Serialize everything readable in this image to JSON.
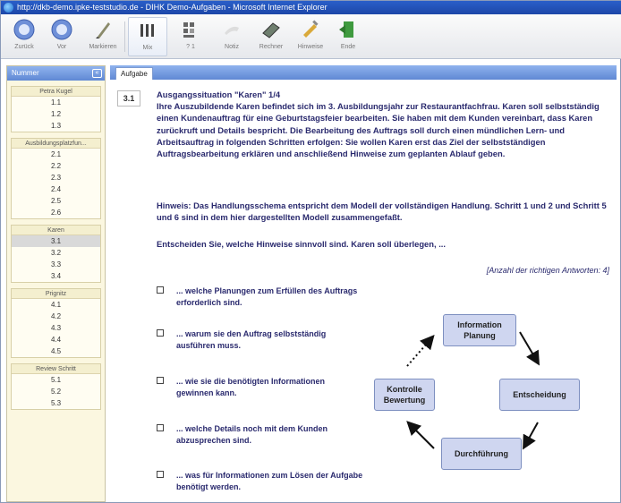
{
  "window": {
    "title": "http://dkb-demo.ipke-teststudio.de - DIHK Demo-Aufgaben - Microsoft Internet Explorer"
  },
  "toolbar": {
    "buttons": [
      {
        "label": "Zurück",
        "icon": "back-arrow-icon"
      },
      {
        "label": "Vor",
        "icon": "forward-arrow-icon"
      },
      {
        "label": "Markieren",
        "icon": "pen-icon"
      },
      {
        "label": "Mix",
        "icon": "columns-icon"
      },
      {
        "label": "? 1",
        "icon": "grid-icon"
      },
      {
        "label": "Notiz",
        "icon": "note-icon"
      },
      {
        "label": "Rechner",
        "icon": "calculator-icon"
      },
      {
        "label": "Hinweise",
        "icon": "pencil-icon"
      },
      {
        "label": "Ende",
        "icon": "exit-icon"
      }
    ]
  },
  "sidebar": {
    "header": "Nummer",
    "groups": [
      {
        "title": "Petra Kugel",
        "items": [
          "1.1",
          "1.2",
          "1.3"
        ]
      },
      {
        "title": "Ausbildungsplatzfun...",
        "items": [
          "2.1",
          "2.2",
          "2.3",
          "2.4",
          "2.5",
          "2.6"
        ]
      },
      {
        "title": "Karen",
        "items": [
          "3.1",
          "3.2",
          "3.3",
          "3.4"
        ],
        "selected": "3.1"
      },
      {
        "title": "Prignitz",
        "items": [
          "4.1",
          "4.2",
          "4.3",
          "4.4",
          "4.5"
        ]
      },
      {
        "title": "Review Schritt",
        "items": [
          "5.1",
          "5.2",
          "5.3"
        ]
      }
    ]
  },
  "main": {
    "tab": "Aufgabe",
    "question_number": "3.1",
    "heading": "Ausgangssituation \"Karen\" 1/4",
    "intro": "Ihre Auszubildende Karen befindet sich im 3. Ausbildungsjahr zur Restaurantfachfrau. Karen soll selbstständig einen Kundenauftrag für eine Geburtstagsfeier bearbeiten. Sie haben mit dem Kunden vereinbart, dass Karen zurückruft und Details bespricht. Die Bearbeitung des Auftrags soll durch einen mündlichen Lern- und Arbeitsauftrag in folgenden Schritten erfolgen: Sie wollen Karen erst das Ziel der selbstständigen Auftragsbearbeitung erklären und anschließend Hinweise zum geplanten Ablauf geben.",
    "hint": "Hinweis: Das Handlungsschema entspricht dem Modell der vollständigen Handlung. Schritt 1 und 2 und Schritt 5 und 6 sind in dem hier dargestellten Modell zusammengefaßt.",
    "instruction": "Entscheiden Sie, welche Hinweise sinnvoll sind. Karen soll überlegen, ...",
    "answer_count": "[Anzahl der richtigen Antworten: 4]",
    "options": [
      "... welche Planungen zum Erfüllen des Auftrags erforderlich sind.",
      "... warum sie den Auftrag selbstständig ausführen muss.",
      "... wie sie die benötigten Informationen gewinnen kann.",
      "... welche Details noch mit dem Kunden abzusprechen sind.",
      "... was für Informationen zum Lösen der Aufgabe benötigt werden."
    ],
    "diagram": {
      "info": "Information\nPlanung",
      "entscheidung": "Entscheidung",
      "durchfuehrung": "Durchführung",
      "kontrolle": "Kontrolle\nBewertung"
    }
  }
}
